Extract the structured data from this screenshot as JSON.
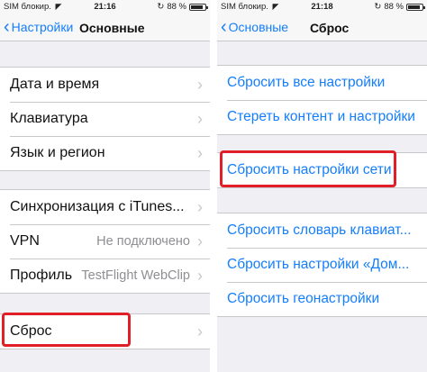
{
  "left": {
    "status": {
      "carrier": "SIM блокир.",
      "time": "21:16",
      "battery": "88 %",
      "battery_level": 0.88
    },
    "nav": {
      "back_label": "Настройки",
      "title": "Основные"
    },
    "group1": [
      {
        "label": "Дата и время"
      },
      {
        "label": "Клавиатура"
      },
      {
        "label": "Язык и регион"
      }
    ],
    "group2": [
      {
        "label": "Синхронизация с iTunes..."
      },
      {
        "label": "VPN",
        "value": "Не подключено"
      },
      {
        "label": "Профиль",
        "value": "TestFlight WebClip"
      }
    ],
    "group3": [
      {
        "label": "Сброс"
      }
    ]
  },
  "right": {
    "status": {
      "carrier": "SIM блокир.",
      "time": "21:18",
      "battery": "88 %",
      "battery_level": 0.88
    },
    "nav": {
      "back_label": "Основные",
      "title": "Сброс"
    },
    "group1": [
      {
        "label": "Сбросить все настройки"
      },
      {
        "label": "Стереть контент и настройки"
      }
    ],
    "group2": [
      {
        "label": "Сбросить настройки сети"
      }
    ],
    "group3": [
      {
        "label": "Сбросить словарь клавиат..."
      },
      {
        "label": "Сбросить настройки «Дом..."
      },
      {
        "label": "Сбросить геонастройки"
      }
    ]
  },
  "icons": {
    "wifi": "wifi-icon",
    "chevron": "chevron-right-icon",
    "back": "chevron-left-icon"
  },
  "colors": {
    "accent": "#157efb",
    "highlight": "#e01f26",
    "background": "#efeff4"
  }
}
